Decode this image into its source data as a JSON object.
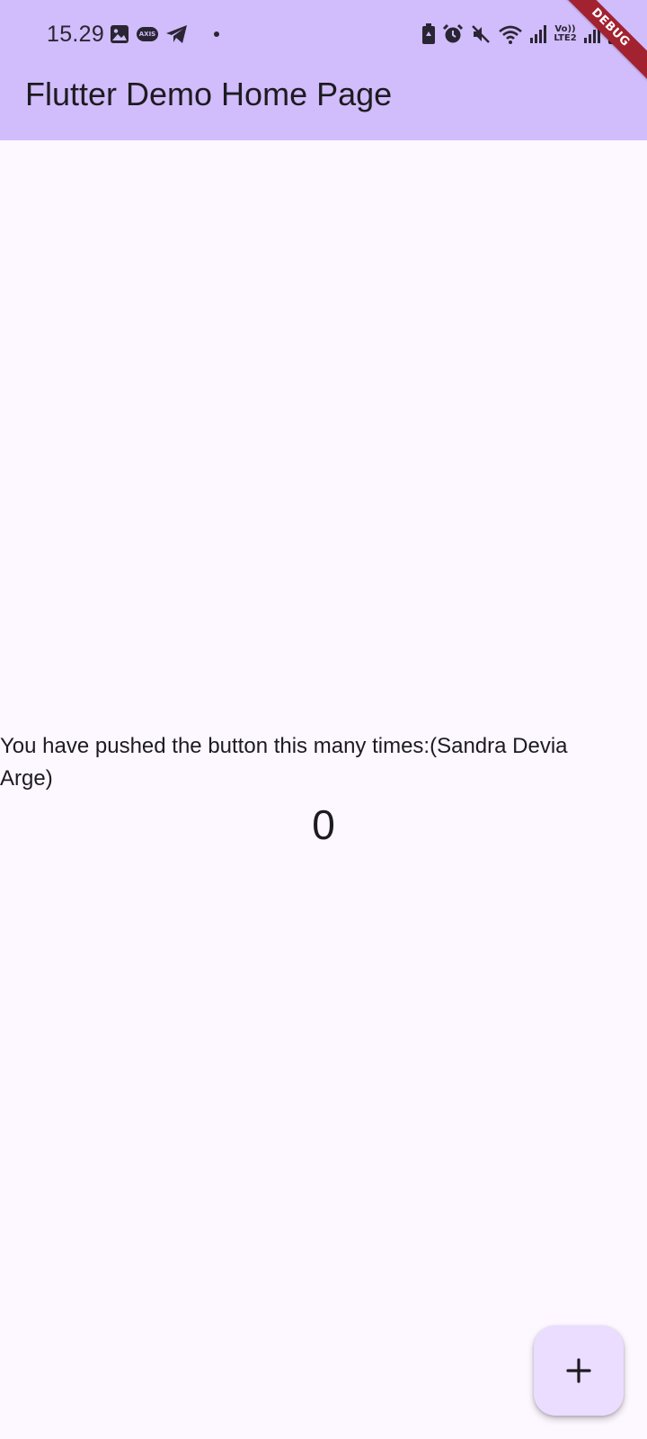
{
  "status_bar": {
    "time": "15.29",
    "left_icons": [
      "image-icon",
      "axis-icon",
      "telegram-icon",
      "notification-dot-icon"
    ],
    "axis_badge_text": "AXIS",
    "right_icons": [
      "battery-saver-icon",
      "alarm-icon",
      "mute-icon",
      "wifi-icon",
      "signal-icon",
      "volte-icon",
      "signal-2-icon",
      "battery-icon"
    ],
    "volte_text_top": "Vo))",
    "volte_text_bottom": "LTE2"
  },
  "app_bar": {
    "title": "Flutter Demo Home Page",
    "color": "#d1bcfc"
  },
  "debug_banner": {
    "label": "DEBUG",
    "color": "#a32230"
  },
  "body": {
    "label": "You have pushed the button this many times:(Sandra Devia Arge)",
    "counter": "0",
    "background": "#fdf7ff"
  },
  "fab": {
    "icon": "plus-icon",
    "color": "#eaddff"
  }
}
